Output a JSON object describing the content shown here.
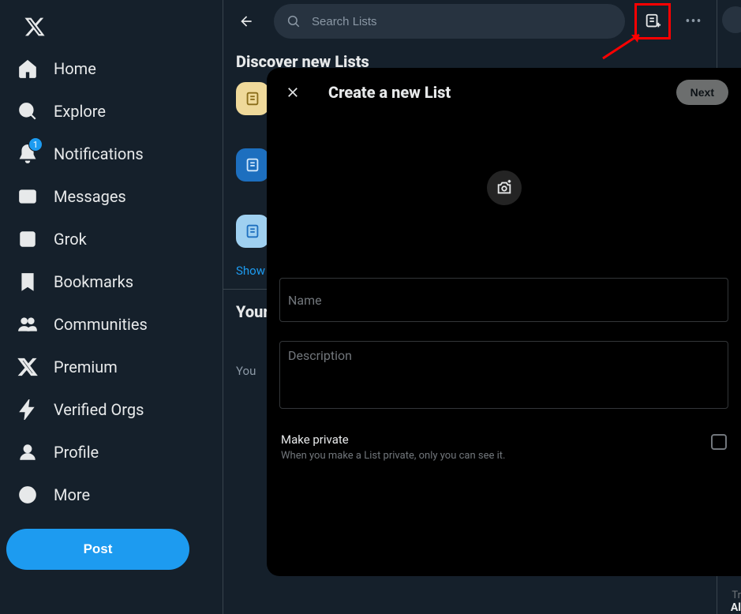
{
  "sidebar": {
    "items": [
      {
        "label": "Home"
      },
      {
        "label": "Explore"
      },
      {
        "label": "Notifications",
        "badge": "1"
      },
      {
        "label": "Messages"
      },
      {
        "label": "Grok"
      },
      {
        "label": "Bookmarks"
      },
      {
        "label": "Communities"
      },
      {
        "label": "Premium"
      },
      {
        "label": "Verified Orgs"
      },
      {
        "label": "Profile"
      },
      {
        "label": "More"
      }
    ],
    "post_label": "Post"
  },
  "topbar": {
    "search_placeholder": "Search Lists",
    "more_dots": "•••"
  },
  "sections": {
    "discover_title": "Discover new Lists",
    "show_more": "Show",
    "your_lists_title": "Your",
    "your_lists_sub": "You"
  },
  "modal": {
    "title": "Create a new List",
    "next_label": "Next",
    "name_label": "Name",
    "desc_label": "Description",
    "private_title": "Make private",
    "private_sub": "When you make a List private, only you can see it."
  },
  "right": {
    "letterT": "T",
    "tr": "Tr",
    "al": "Al"
  }
}
